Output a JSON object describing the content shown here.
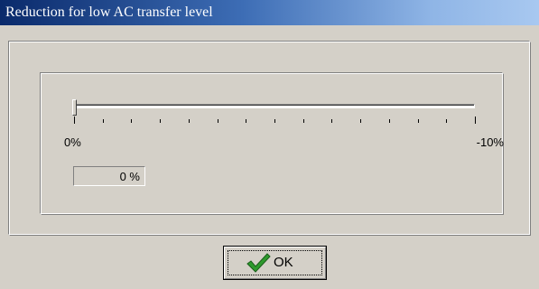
{
  "window": {
    "title": "Reduction for low AC transfer level"
  },
  "slider": {
    "min_label": "0%",
    "max_label": "-10%",
    "value_fraction": 0.0,
    "tick_count": 15
  },
  "value_display": {
    "text": "0 %"
  },
  "buttons": {
    "ok_label": "OK",
    "ok_icon": "checkmark-icon"
  },
  "colors": {
    "title_start": "#0a2a6b",
    "title_end": "#a8c8f0",
    "face": "#d4d0c8",
    "checkmark": "#2e9a2e"
  }
}
